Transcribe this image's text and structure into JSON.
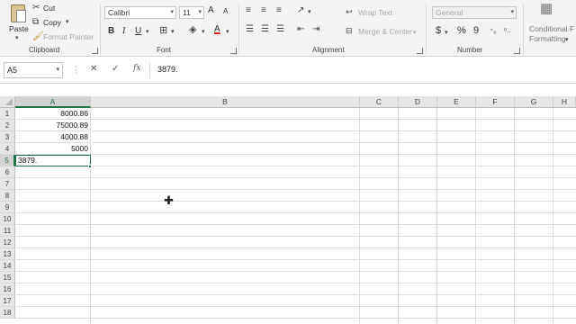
{
  "ribbon": {
    "clipboard": {
      "paste": "Paste",
      "cut": "Cut",
      "copy": "Copy",
      "format_painter": "Format Painter",
      "label": "Clipboard"
    },
    "font": {
      "name": "Calibri",
      "size": "11",
      "grow": "A",
      "shrink": "A",
      "bold": "B",
      "italic": "I",
      "underline": "U",
      "font_color_letter": "A",
      "label": "Font",
      "font_color": "#e02020"
    },
    "alignment": {
      "wrap_text": "Wrap Text",
      "merge_center": "Merge & Center",
      "label": "Alignment"
    },
    "number": {
      "format": "General",
      "currency": "$",
      "percent": "%",
      "comma": "9",
      "label": "Number"
    },
    "styles": {
      "conditional": "Conditional",
      "formatting": "Formatting",
      "cut_off": "F"
    }
  },
  "formula_bar": {
    "name_box": "A5",
    "cancel": "✕",
    "enter": "✓",
    "fx": "fx",
    "content": "3879."
  },
  "grid": {
    "columns": [
      "A",
      "B",
      "C",
      "D",
      "E",
      "F",
      "G",
      "H"
    ],
    "selected_column": "A",
    "rows": [
      "1",
      "2",
      "3",
      "4",
      "5",
      "6",
      "7",
      "8",
      "9",
      "10",
      "11",
      "12",
      "13",
      "14",
      "15",
      "16",
      "17",
      "18"
    ],
    "selected_row": "5",
    "cells": {
      "A1": "8000.86",
      "A2": "75000.89",
      "A3": "4000.88",
      "A4": "5000",
      "A5": "3879."
    },
    "accent": "#217346"
  }
}
